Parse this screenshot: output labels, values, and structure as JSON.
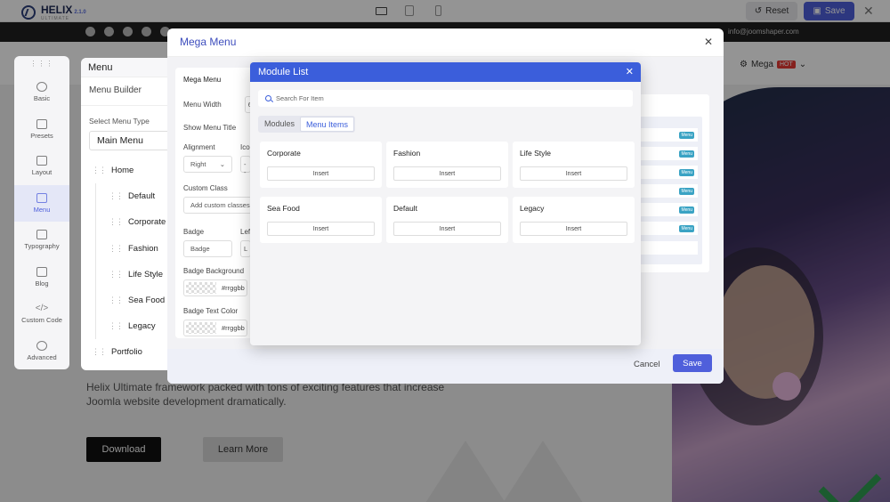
{
  "topbar": {
    "logo_text": "HELIX",
    "logo_sub": "ULTIMATE",
    "logo_version": "2.1.0",
    "devices": [
      "desktop-icon",
      "tablet-icon",
      "mobile-icon"
    ],
    "reset_label": "Reset",
    "save_label": "Save"
  },
  "site": {
    "email": "info@joomshaper.com",
    "nav_mega": "Mega",
    "nav_hot": "HOT",
    "hero_text": "Helix Ultimate framework packed with tons of exciting features that increase Joomla website development dramatically.",
    "download_label": "Download",
    "learn_more_label": "Learn More"
  },
  "sidebar": {
    "items": [
      {
        "label": "Basic",
        "icon": "gear-icon"
      },
      {
        "label": "Presets",
        "icon": "sliders-icon"
      },
      {
        "label": "Layout",
        "icon": "layout-icon"
      },
      {
        "label": "Menu",
        "icon": "menu-icon"
      },
      {
        "label": "Typography",
        "icon": "typography-icon"
      },
      {
        "label": "Blog",
        "icon": "blog-icon"
      },
      {
        "label": "Custom Code",
        "icon": "code-icon"
      },
      {
        "label": "Advanced",
        "icon": "advanced-icon"
      }
    ]
  },
  "menu_panel": {
    "title": "Menu",
    "builder_label": "Menu Builder",
    "select_label": "Select Menu Type",
    "select_value": "Main Menu",
    "tree": [
      {
        "label": "Home",
        "child": false
      },
      {
        "label": "Default",
        "child": true
      },
      {
        "label": "Corporate",
        "child": true
      },
      {
        "label": "Fashion",
        "child": true
      },
      {
        "label": "Life Style",
        "child": true
      },
      {
        "label": "Sea Food",
        "child": true
      },
      {
        "label": "Legacy",
        "child": true
      },
      {
        "label": "Portfolio",
        "child": false
      }
    ]
  },
  "mega_modal": {
    "title": "Mega Menu",
    "form_title": "Mega Menu",
    "menu_width_label": "Menu Width",
    "menu_width_value": "600",
    "show_title_label": "Show Menu Title",
    "alignment_label": "Alignment",
    "alignment_value": "Right",
    "icon_label": "Ico",
    "icon_value": "--",
    "custom_class_label": "Custom Class",
    "custom_class_placeholder": "Add custom classes",
    "badge_label": "Badge",
    "badge_placeholder": "Badge",
    "badge_pos_label": "Lef",
    "badge_pos_value": "L",
    "badge_bg_label": "Badge Background",
    "badge_bg_value": "#rrggbb",
    "badge_text_label": "Badge Text Color",
    "badge_text_value": "#rrggbb",
    "menu_tag": "Menu",
    "cancel_label": "Cancel",
    "save_label": "Save"
  },
  "module_list": {
    "title": "Module List",
    "search_placeholder": "Search For Item",
    "tabs": [
      "Modules",
      "Menu Items"
    ],
    "active_tab": "Menu Items",
    "items": [
      {
        "title": "Corporate",
        "button": "Insert"
      },
      {
        "title": "Fashion",
        "button": "Insert"
      },
      {
        "title": "Life Style",
        "button": "Insert"
      },
      {
        "title": "Sea Food",
        "button": "Insert"
      },
      {
        "title": "Default",
        "button": "Insert"
      },
      {
        "title": "Legacy",
        "button": "Insert"
      }
    ]
  },
  "colors": {
    "accent": "#4f5fdb",
    "module_header": "#3b5edb",
    "hot_badge": "#e53935",
    "menu_tag": "#3aa3c4"
  }
}
